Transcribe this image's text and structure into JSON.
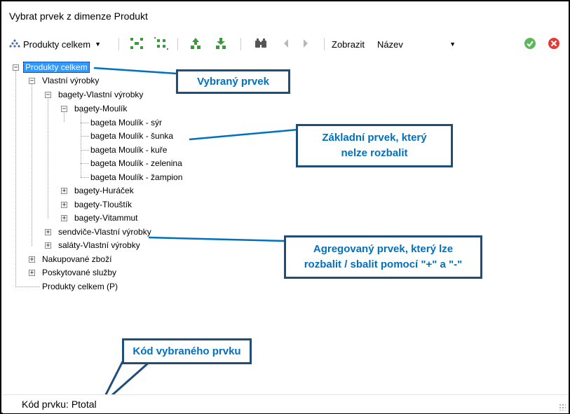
{
  "window": {
    "title": "Vybrat prvek z dimenze Produkt"
  },
  "toolbar": {
    "hierarchy_label": "Produkty celkem",
    "show_label": "Zobrazit",
    "show_value": "Název",
    "icons": [
      "hierarchy-icon",
      "expand-all-icon",
      "collapse-all-icon",
      "move-up-icon",
      "move-down-icon",
      "find-icon",
      "previous-icon",
      "next-icon",
      "confirm-icon",
      "cancel-icon"
    ]
  },
  "tree": {
    "nodes": [
      {
        "label": "Produkty celkem",
        "state": "expanded",
        "selected": true
      },
      {
        "label": "Vlastní výrobky",
        "state": "expanded"
      },
      {
        "label": "bagety-Vlastní výrobky",
        "state": "expanded"
      },
      {
        "label": "bagety-Moulík",
        "state": "expanded"
      },
      {
        "label": "bageta Moulík - sýr",
        "state": "leaf"
      },
      {
        "label": "bageta Moulík - šunka",
        "state": "leaf"
      },
      {
        "label": "bageta Moulík - kuře",
        "state": "leaf"
      },
      {
        "label": "bageta Moulík - zelenina",
        "state": "leaf"
      },
      {
        "label": "bageta Moulík - žampion",
        "state": "leaf"
      },
      {
        "label": "bagety-Huráček",
        "state": "collapsed"
      },
      {
        "label": "bagety-Tlouštík",
        "state": "collapsed"
      },
      {
        "label": "bagety-Vitammut",
        "state": "collapsed"
      },
      {
        "label": "sendviče-Vlastní výrobky",
        "state": "collapsed"
      },
      {
        "label": "saláty-Vlastní výrobky",
        "state": "collapsed"
      },
      {
        "label": "Nakupované zboží",
        "state": "collapsed"
      },
      {
        "label": "Poskytované služby",
        "state": "collapsed"
      },
      {
        "label": "Produkty celkem (P)",
        "state": "leaf"
      }
    ]
  },
  "callouts": {
    "selected": "Vybraný prvek",
    "leaf_line1": "Základní prvek, který",
    "leaf_line2": "nelze rozbalit",
    "agg_line1": "Agregovaný prvek, který lze",
    "agg_line2": "rozbalit / sbalit pomocí \"+\" a \"-\"",
    "code": "Kód vybraného prvku"
  },
  "status": {
    "text": "Kód prvku: Ptotal"
  },
  "colors": {
    "selection": "#3399ff",
    "callout_text": "#0070c0",
    "callout_border": "#1f4e79",
    "confirm": "#5cb85c",
    "cancel": "#e53935"
  }
}
